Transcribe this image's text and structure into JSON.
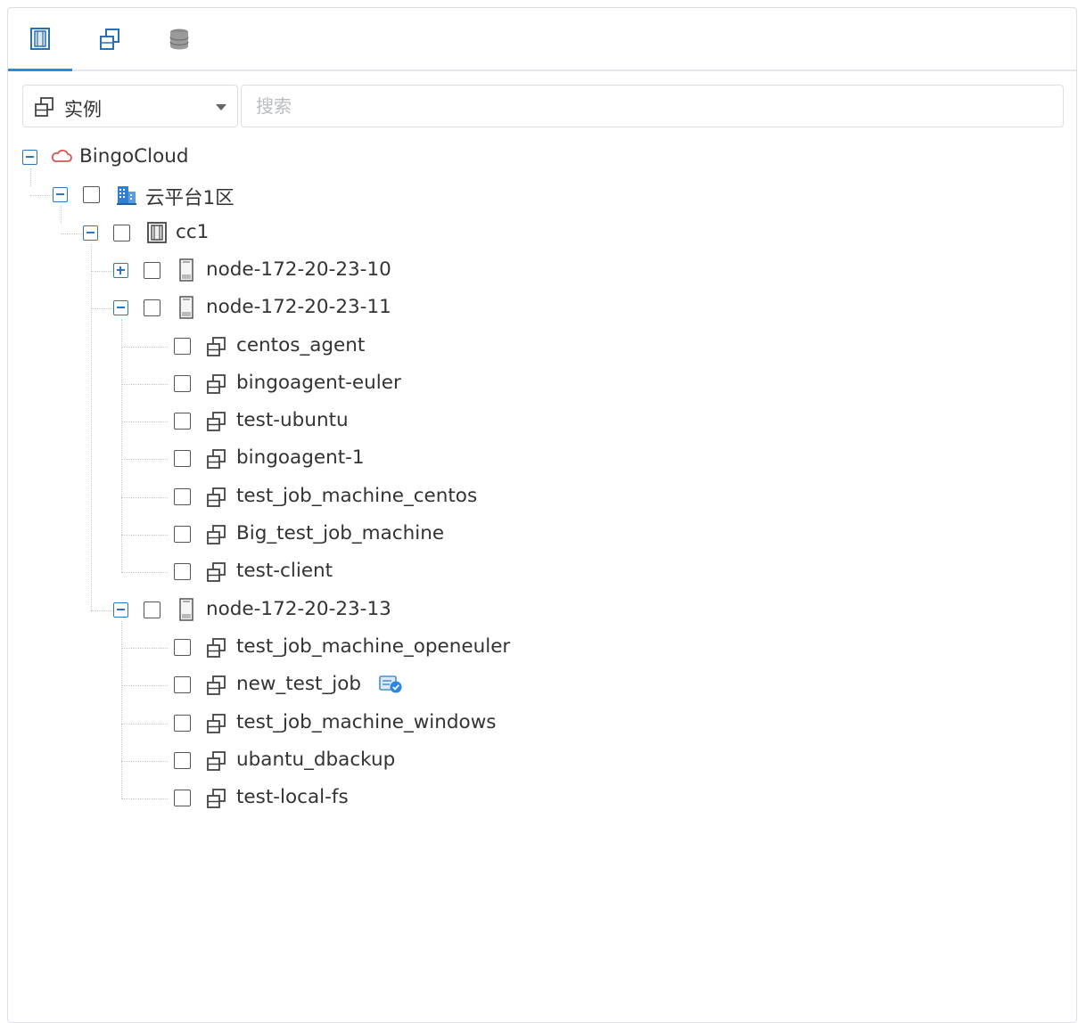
{
  "tabs": [
    {
      "icon": "cluster-icon",
      "active": true
    },
    {
      "icon": "instance-icon",
      "active": false
    },
    {
      "icon": "database-icon",
      "active": false
    }
  ],
  "filter": {
    "type_icon": "instance-icon",
    "type_label": "实例",
    "search_placeholder": "搜索"
  },
  "tree": {
    "root": {
      "label": "BingoCloud",
      "icon": "cloud-icon",
      "expanded": true
    },
    "zone": {
      "label": "云平台1区",
      "icon": "building-icon",
      "expanded": true
    },
    "cluster": {
      "label": "cc1",
      "icon": "cluster-icon",
      "expanded": true
    },
    "nodes": [
      {
        "label": "node-172-20-23-10",
        "icon": "server-icon",
        "expanded": false,
        "children": []
      },
      {
        "label": "node-172-20-23-11",
        "icon": "server-icon",
        "expanded": true,
        "children": [
          {
            "label": "centos_agent",
            "icon": "instance-icon"
          },
          {
            "label": "bingoagent-euler",
            "icon": "instance-icon"
          },
          {
            "label": "test-ubuntu",
            "icon": "instance-icon"
          },
          {
            "label": "bingoagent-1",
            "icon": "instance-icon"
          },
          {
            "label": "test_job_machine_centos",
            "icon": "instance-icon"
          },
          {
            "label": "Big_test_job_machine",
            "icon": "instance-icon"
          },
          {
            "label": "test-client",
            "icon": "instance-icon"
          }
        ]
      },
      {
        "label": "node-172-20-23-13",
        "icon": "server-icon",
        "expanded": true,
        "children": [
          {
            "label": "test_job_machine_openeuler",
            "icon": "instance-icon"
          },
          {
            "label": "new_test_job",
            "icon": "instance-icon",
            "badge": "job-verified-icon"
          },
          {
            "label": "test_job_machine_windows",
            "icon": "instance-icon"
          },
          {
            "label": "ubantu_dbackup",
            "icon": "instance-icon"
          },
          {
            "label": "test-local-fs",
            "icon": "instance-icon"
          }
        ]
      }
    ]
  },
  "colors": {
    "accent": "#2c8bd8",
    "toggle": "#2c75c4",
    "cloud": "#d9534f",
    "building": "#2f7fd1"
  }
}
